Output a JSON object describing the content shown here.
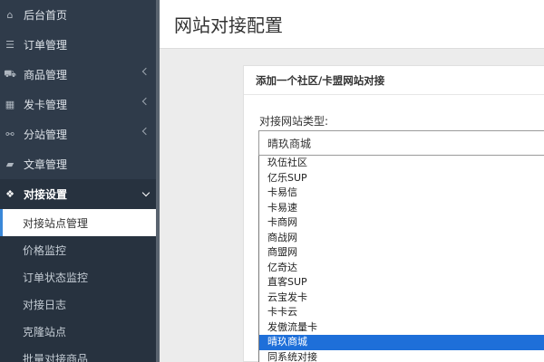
{
  "sidebar": {
    "items": [
      {
        "label": "后台首页",
        "icon": "home-icon",
        "glyph": "⌂"
      },
      {
        "label": "订单管理",
        "icon": "list-icon",
        "glyph": "☰"
      },
      {
        "label": "商品管理",
        "icon": "cart-icon",
        "glyph": "⛟"
      },
      {
        "label": "发卡管理",
        "icon": "grid-icon",
        "glyph": "▦"
      },
      {
        "label": "分站管理",
        "icon": "sitemap-icon",
        "glyph": "⚯"
      },
      {
        "label": "文章管理",
        "icon": "book-icon",
        "glyph": "▰"
      },
      {
        "label": "对接设置",
        "icon": "cubes-icon",
        "glyph": "❖"
      }
    ],
    "sub_items": [
      {
        "label": "对接站点管理"
      },
      {
        "label": "价格监控"
      },
      {
        "label": "订单状态监控"
      },
      {
        "label": "对接日志"
      },
      {
        "label": "克隆站点"
      },
      {
        "label": "批量对接商品"
      }
    ]
  },
  "page": {
    "title": "网站对接配置"
  },
  "panel": {
    "heading": "添加一个社区/卡盟网站对接",
    "type_label": "对接网站类型:",
    "selected_value": "晴玖商城",
    "options": [
      "玖伍社区",
      "亿乐SUP",
      "卡易信",
      "卡易速",
      "卡商网",
      "商战网",
      "商盟网",
      "亿奇达",
      "直客SUP",
      "云宝发卡",
      "卡卡云",
      "发傲流量卡",
      "晴玖商城",
      "同系统对接"
    ],
    "selected_index": 12
  },
  "colors": {
    "sidebar_bg": "#2f3b4a",
    "highlight": "#1e6fd9",
    "active_bar": "#3a88d8"
  }
}
